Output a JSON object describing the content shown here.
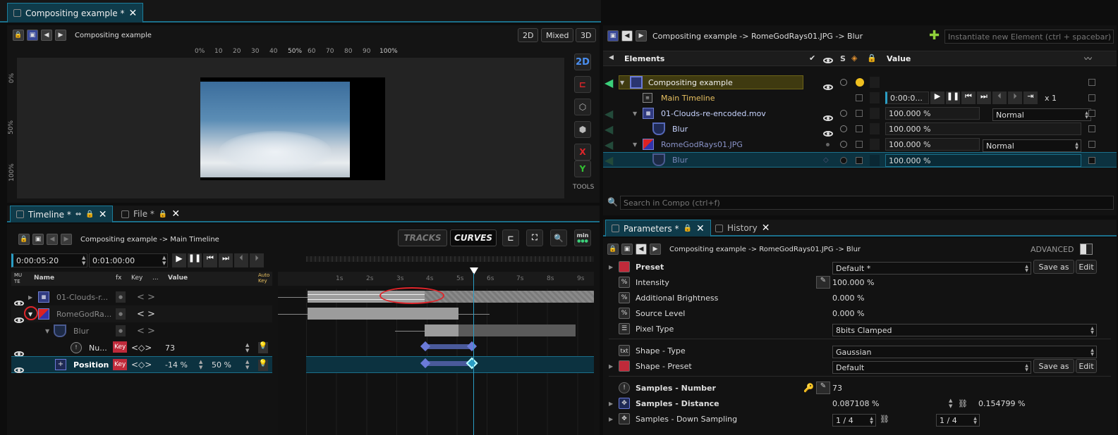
{
  "window_tab": {
    "label": "Compositing example *"
  },
  "viewer": {
    "title": "Compositing example",
    "modes": [
      "2D",
      "Mixed",
      "3D"
    ],
    "mode_label": "2D",
    "ruler_top": [
      "0%",
      "10",
      "20",
      "30",
      "40",
      "50%",
      "60",
      "70",
      "80",
      "90",
      "100%"
    ],
    "ruler_left": [
      "0%",
      "50%",
      "100%"
    ],
    "tools": {
      "btn_2d": "2D",
      "x": "X",
      "y": "Y",
      "label": "TOOLS"
    }
  },
  "elements_panel": {
    "breadcrumb": "Compositing example -> RomeGodRays01.JPG -> Blur",
    "instantiate_placeholder": "Instantiate new Element (ctrl + spacebar)",
    "header": {
      "elements": "Elements",
      "s": "S",
      "value": "Value"
    },
    "rows": [
      {
        "name": "Compositing example",
        "value": ""
      },
      {
        "name": "Main Timeline",
        "value": "0:00:0..."
      },
      {
        "name": "01-Clouds-re-encoded.mov",
        "value": "100.000 %",
        "blend": "Normal"
      },
      {
        "name": "Blur",
        "value": "100.000 %"
      },
      {
        "name": "RomeGodRays01.JPG",
        "value": "100.000 %",
        "blend": "Normal"
      },
      {
        "name": "Blur",
        "value": "100.000 %"
      }
    ],
    "speed": "x 1",
    "search_placeholder": "Search in Compo (ctrl+f)"
  },
  "timeline_tabs": {
    "timeline": "Timeline *",
    "file": "File *"
  },
  "timeline": {
    "breadcrumb": "Compositing example -> Main Timeline",
    "tracks_btn": "TRACKS",
    "curves_btn": "CURVES",
    "min_label": "min",
    "current_time": "0:00:05:20",
    "duration": "0:01:00:00",
    "header": {
      "mute": "MU\nTE",
      "name": "Name",
      "fx": "fx",
      "key": "Key",
      "dots": "...",
      "value": "Value",
      "auto_key": "Auto\nKey"
    },
    "ruler": [
      "1s",
      "2s",
      "3s",
      "4s",
      "5s",
      "6s",
      "7s",
      "8s",
      "9s"
    ],
    "layers": [
      {
        "name": "01-Clouds-r..."
      },
      {
        "name": "RomeGodRa..."
      },
      {
        "name": "Blur"
      },
      {
        "name": "Nu...",
        "key": "Key",
        "value": "73"
      },
      {
        "name": "Position",
        "key": "Key",
        "value1": "-14 %",
        "value2": "50 %"
      }
    ]
  },
  "params_tabs": {
    "parameters": "Parameters *",
    "history": "History"
  },
  "parameters": {
    "breadcrumb": "Compositing example -> RomeGodRays01.JPG -> Blur",
    "advanced": "ADVANCED",
    "rows": [
      {
        "label": "Preset",
        "value": "Default *",
        "save": "Save as",
        "edit": "Edit"
      },
      {
        "label": "Intensity",
        "value": "100.000 %"
      },
      {
        "label": "Additional Brightness",
        "value": "0.000 %"
      },
      {
        "label": "Source Level",
        "value": "0.000 %"
      },
      {
        "label": "Pixel Type",
        "value": "8bits Clamped"
      },
      {
        "label": "Shape - Type",
        "value": "Gaussian"
      },
      {
        "label": "Shape - Preset",
        "value": "Default",
        "save": "Save as",
        "edit": "Edit"
      },
      {
        "label": "Samples - Number",
        "value": "73"
      },
      {
        "label": "Samples - Distance",
        "value": "0.087108 %",
        "value2": "0.154799 %"
      },
      {
        "label": "Samples - Down Sampling",
        "value": "1 / 4",
        "value2": "1 / 4"
      }
    ],
    "icon_labels": {
      "txt": "txt",
      "pct": "%"
    }
  },
  "colors": {
    "accent": "#1b6f8a",
    "highlight_red": "#e0252a",
    "key_badge": "#c02a3a",
    "selected_row": "#0c3240",
    "comp_row": "#3f3a10"
  }
}
